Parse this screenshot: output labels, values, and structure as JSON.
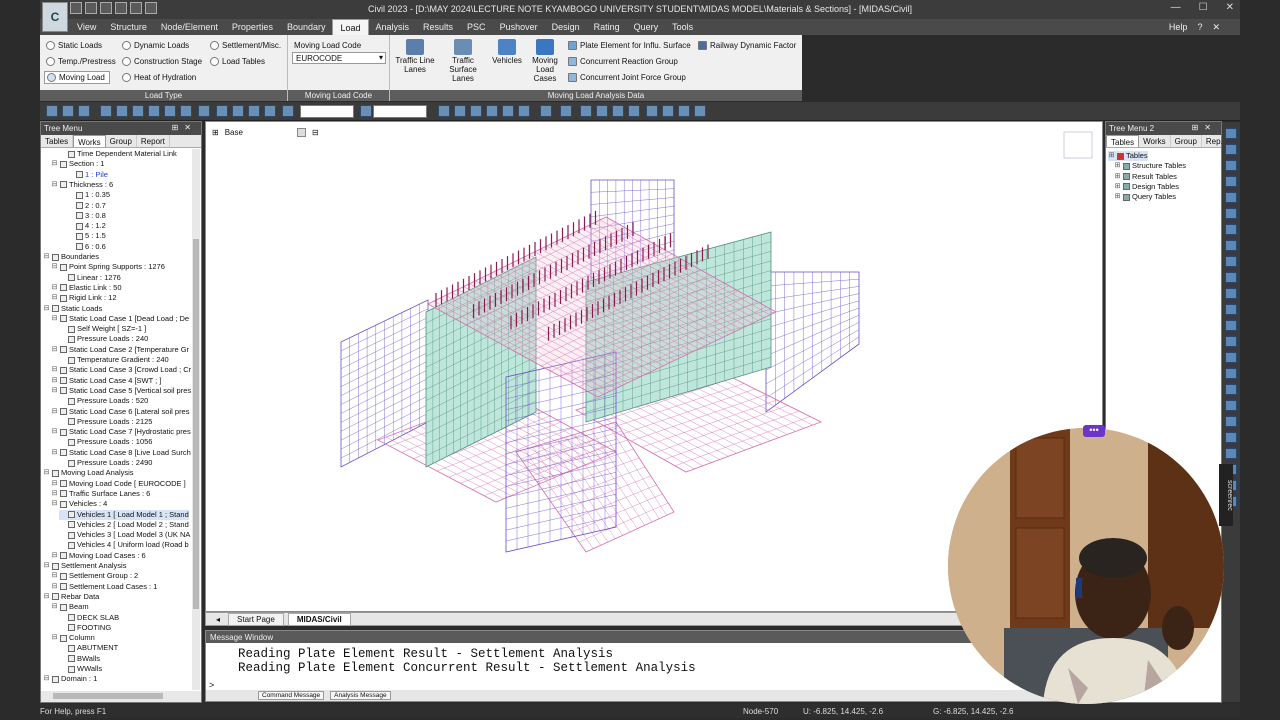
{
  "window": {
    "title": "Civil 2023 - [D:\\MAY 2024\\LECTURE NOTE KYAMBOGO UNIVERSITY STUDENT\\MIDAS MODEL\\Materials & Sections] - [MIDAS/Civil]",
    "help": "Help",
    "logo": "C"
  },
  "menu": [
    "View",
    "Structure",
    "Node/Element",
    "Properties",
    "Boundary",
    "Load",
    "Analysis",
    "Results",
    "PSC",
    "Pushover",
    "Design",
    "Rating",
    "Query",
    "Tools"
  ],
  "ribbon": {
    "load_type": {
      "label": "Load Type",
      "col1": [
        "Static Loads",
        "Temp./Prestress",
        "Moving Load"
      ],
      "col2": [
        "Dynamic Loads",
        "Construction Stage",
        "Heat of Hydration"
      ],
      "col3": [
        "Settlement/Misc.",
        "Load Tables"
      ]
    },
    "moving_load_code": {
      "label": "Moving Load Code",
      "title": "Moving Load Code",
      "value": "EUROCODE"
    },
    "analysis_data": {
      "label": "Moving Load Analysis Data",
      "traffic_line_1": "Traffic Line",
      "traffic_line_2": "Lanes",
      "traffic_surface_1": "Traffic Surface",
      "traffic_surface_2": "Lanes",
      "vehicles": "Vehicles",
      "moving_cases_1": "Moving",
      "moving_cases_2": "Load Cases",
      "plate_element": "Plate Element for Influ. Surface",
      "concurrent_reaction": "Concurrent Reaction Group",
      "concurrent_joint": "Concurrent Joint Force Group",
      "railway": "Railway Dynamic Factor"
    }
  },
  "tree_menu": {
    "title": "Tree Menu",
    "tabs": [
      "Tables",
      "Works",
      "Group",
      "Report"
    ],
    "active_tab": "Works",
    "nodes": [
      {
        "t": "Time Dependent Material Link",
        "lvl": 2
      },
      {
        "t": "Section : 1",
        "lvl": 1
      },
      {
        "t": "1 : Pile",
        "lvl": 3
      },
      {
        "t": "Thickness : 6",
        "lvl": 1
      },
      {
        "t": "1 : 0.35",
        "lvl": 3
      },
      {
        "t": "2 : 0.7",
        "lvl": 3
      },
      {
        "t": "3 : 0.8",
        "lvl": 3
      },
      {
        "t": "4 : 1.2",
        "lvl": 3
      },
      {
        "t": "5 : 1.5",
        "lvl": 3
      },
      {
        "t": "6 : 0.6",
        "lvl": 3
      },
      {
        "t": "Boundaries",
        "lvl": 0
      },
      {
        "t": "Point Spring Supports : 1276",
        "lvl": 1
      },
      {
        "t": "Linear : 1276",
        "lvl": 2
      },
      {
        "t": "Elastic Link : 50",
        "lvl": 1
      },
      {
        "t": "Rigid Link : 12",
        "lvl": 1
      },
      {
        "t": "Static Loads",
        "lvl": 0
      },
      {
        "t": "Static Load Case 1 [Dead Load ; De",
        "lvl": 1
      },
      {
        "t": "Self Weight [ SZ=-1 ]",
        "lvl": 2
      },
      {
        "t": "Pressure Loads : 240",
        "lvl": 2
      },
      {
        "t": "Static Load Case 2 [Temperature Gr",
        "lvl": 1
      },
      {
        "t": "Temperature Gradient : 240",
        "lvl": 2
      },
      {
        "t": "Static Load Case 3 [Crowd Load ; Cr",
        "lvl": 1
      },
      {
        "t": "Static Load Case 4 [SWT ; ]",
        "lvl": 1
      },
      {
        "t": "Static Load Case 5 [Vertical soil pres",
        "lvl": 1
      },
      {
        "t": "Pressure Loads : 520",
        "lvl": 2
      },
      {
        "t": "Static Load Case 6 [Lateral soil pres",
        "lvl": 1
      },
      {
        "t": "Pressure Loads : 2125",
        "lvl": 2
      },
      {
        "t": "Static Load Case 7 [Hydrostatic pres",
        "lvl": 1
      },
      {
        "t": "Pressure Loads : 1056",
        "lvl": 2
      },
      {
        "t": "Static Load Case 8 [Live Load Surch",
        "lvl": 1
      },
      {
        "t": "Pressure Loads : 2490",
        "lvl": 2
      },
      {
        "t": "Moving Load Analysis",
        "lvl": 0
      },
      {
        "t": "Moving Load Code [ EUROCODE ]",
        "lvl": 1
      },
      {
        "t": "Traffic Surface Lanes : 6",
        "lvl": 1
      },
      {
        "t": "Vehicles : 4",
        "lvl": 1
      },
      {
        "t": "Vehicles 1 [ Load Model 1 ; Stand",
        "lvl": 2,
        "sel": true
      },
      {
        "t": "Vehicles 2 [ Load Model 2 ; Stand",
        "lvl": 2
      },
      {
        "t": "Vehicles 3 [ Load Model 3 (UK NA",
        "lvl": 2
      },
      {
        "t": "Vehicles 4 [ Uniform load (Road b",
        "lvl": 2
      },
      {
        "t": "Moving Load Cases : 6",
        "lvl": 1
      },
      {
        "t": "Settlement Analysis",
        "lvl": 0
      },
      {
        "t": "Settlement Group : 2",
        "lvl": 1
      },
      {
        "t": "Settlement Load Cases : 1",
        "lvl": 1
      },
      {
        "t": "Rebar Data",
        "lvl": 0
      },
      {
        "t": "Beam",
        "lvl": 1
      },
      {
        "t": "DECK SLAB",
        "lvl": 2
      },
      {
        "t": "FOOTING",
        "lvl": 2
      },
      {
        "t": "Column",
        "lvl": 1
      },
      {
        "t": "ABUTMENT",
        "lvl": 2
      },
      {
        "t": "BWalls",
        "lvl": 2
      },
      {
        "t": "WWalls",
        "lvl": 2
      },
      {
        "t": "Domain : 1",
        "lvl": 0
      }
    ]
  },
  "tree_menu2": {
    "title": "Tree Menu 2",
    "tabs": [
      "Tables",
      "Works",
      "Group",
      "Rep..."
    ],
    "nodes": [
      "Tables",
      "Structure Tables",
      "Result Tables",
      "Design Tables",
      "Query Tables"
    ]
  },
  "viewport": {
    "view_label": "Base",
    "tabs": [
      "Start Page",
      "MIDAS/Civil"
    ]
  },
  "message_window": {
    "title": "Message Window",
    "lines": [
      "Reading Plate Element Result - Settlement Analysis",
      "Reading Plate Element Concurrent Result - Settlement Analysis"
    ],
    "prompt": ">",
    "tabs": [
      "Command Message",
      "Analysis Message"
    ]
  },
  "status": {
    "help": "For Help, press F1",
    "node": "Node-570",
    "ucs": "U: -6.825, 14.425, -2.6",
    "global": "G: -6.825, 14.425, -2.6"
  },
  "overlay": {
    "recorder": "screenrec",
    "more": "•••"
  },
  "colors": {
    "mesh": "#6a4fc8",
    "mesh_pink": "#d66bb0",
    "wall_fill": "#bfe6da",
    "load_arrows": "#8a1a50",
    "active_tab": "#f4f4f4"
  }
}
